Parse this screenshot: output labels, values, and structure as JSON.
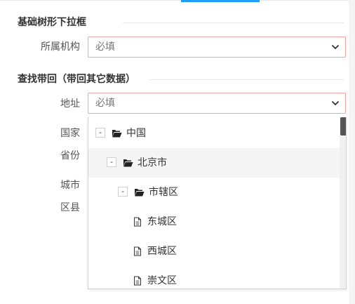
{
  "section1": {
    "title": "基础树形下拉框",
    "field": {
      "label": "所属机构",
      "placeholder": "必填"
    }
  },
  "section2": {
    "title": "查找带回（带回其它数据）",
    "address": {
      "label": "地址",
      "placeholder": "必填"
    },
    "labels": {
      "country": "国家",
      "province": "省份",
      "city": "城市",
      "district": "区县"
    }
  },
  "tree": {
    "items": [
      {
        "label": "中国",
        "toggle": "-",
        "icon": "folder-open-icon"
      },
      {
        "label": "北京市",
        "toggle": "-",
        "icon": "folder-open-icon"
      },
      {
        "label": "市辖区",
        "toggle": "-",
        "icon": "folder-open-icon"
      },
      {
        "label": "东城区",
        "icon": "file-icon"
      },
      {
        "label": "西城区",
        "icon": "file-icon"
      },
      {
        "label": "崇文区",
        "icon": "file-icon"
      }
    ]
  },
  "colors": {
    "accent": "#1E9FFF",
    "required_border": "#f0a5a5",
    "hover_row": "#f5f5f5"
  }
}
